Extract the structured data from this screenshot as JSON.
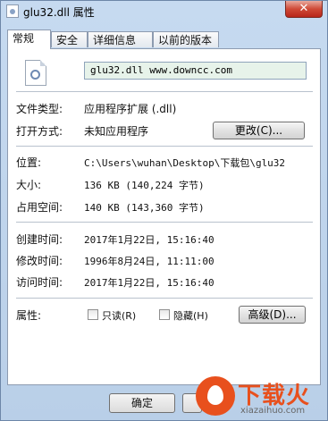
{
  "window": {
    "title": "glu32.dll 属性",
    "close_glyph": "✕"
  },
  "tabs": [
    {
      "label": "常规",
      "active": true
    },
    {
      "label": "安全",
      "active": false
    },
    {
      "label": "详细信息",
      "active": false
    },
    {
      "label": "以前的版本",
      "active": false
    }
  ],
  "file": {
    "name": "glu32.dll  www.downcc.com"
  },
  "props": {
    "type_label": "文件类型:",
    "type_value": "应用程序扩展 (.dll)",
    "opens_label": "打开方式:",
    "opens_value": "未知应用程序",
    "change_button": "更改(C)..."
  },
  "location": {
    "location_label": "位置:",
    "location_value": "C:\\Users\\wuhan\\Desktop\\下载包\\glu32",
    "size_label": "大小:",
    "size_value": "136 KB (140,224 字节)",
    "disk_label": "占用空间:",
    "disk_value": "140 KB (143,360 字节)"
  },
  "times": {
    "created_label": "创建时间:",
    "created_value": "2017年1月22日, 15:16:40",
    "modified_label": "修改时间:",
    "modified_value": "1996年8月24日, 11:11:00",
    "accessed_label": "访问时间:",
    "accessed_value": "2017年1月22日, 15:16:40"
  },
  "attributes": {
    "label": "属性:",
    "readonly_label": "只读(R)",
    "readonly_checked": false,
    "hidden_label": "隐藏(H)",
    "hidden_checked": false,
    "advanced_button": "高级(D)..."
  },
  "footer": {
    "ok_button": "确定"
  },
  "watermark": {
    "brand": "下载火",
    "domain": "xiazaihuo.com"
  }
}
